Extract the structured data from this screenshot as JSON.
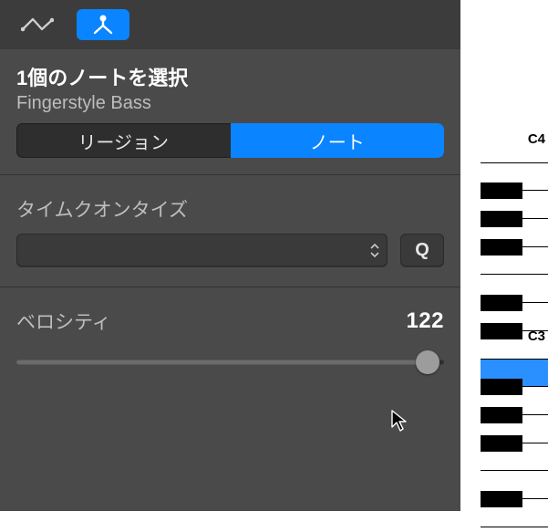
{
  "toolbar": {
    "tool_automation": "automation-curve-icon",
    "tool_midi": "midi-filter-icon"
  },
  "header": {
    "title": "1個のノートを選択",
    "subtitle": "Fingerstyle Bass"
  },
  "tabs": {
    "region": "リージョン",
    "notes": "ノート"
  },
  "quantize": {
    "label": "タイムクオンタイズ",
    "value": "",
    "q_button": "Q"
  },
  "velocity": {
    "label": "ベロシティ",
    "value": "122",
    "max": 127
  },
  "piano": {
    "label_c4": "C4",
    "label_c3": "C3"
  }
}
